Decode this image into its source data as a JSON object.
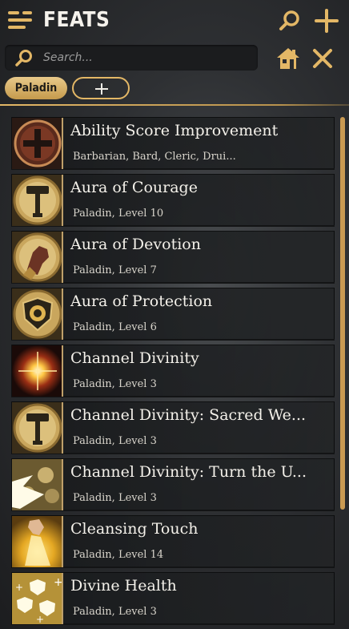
{
  "header": {
    "title": "FEATS"
  },
  "search": {
    "placeholder": "Search..."
  },
  "filters": {
    "active_chip": "Paladin"
  },
  "colors": {
    "accent": "#e3b766",
    "accent_dark": "#c59a4c",
    "background": "#2e3033"
  },
  "feats": [
    {
      "name": "Ability Score Improvement",
      "sub": "Barbarian, Bard, Cleric, Drui...",
      "icon": "plus-emblem-icon"
    },
    {
      "name": "Aura of Courage",
      "sub": "Paladin, Level 10",
      "icon": "hammer-emblem-icon"
    },
    {
      "name": "Aura of Devotion",
      "sub": "Paladin, Level 7",
      "icon": "gauntlet-emblem-icon"
    },
    {
      "name": "Aura of Protection",
      "sub": "Paladin, Level 6",
      "icon": "lion-shield-icon"
    },
    {
      "name": "Channel Divinity",
      "sub": "Paladin, Level 3",
      "icon": "radiant-burst-icon"
    },
    {
      "name": "Channel Divinity: Sacred We...",
      "sub": "Paladin, Level 3",
      "icon": "hammer-emblem-icon"
    },
    {
      "name": "Channel Divinity: Turn the U...",
      "sub": "Paladin, Level 3",
      "icon": "turn-undead-icon"
    },
    {
      "name": "Cleansing Touch",
      "sub": "Paladin, Level 14",
      "icon": "glowing-hand-icon"
    },
    {
      "name": "Divine Health",
      "sub": "Paladin, Level 3",
      "icon": "shields-cross-icon"
    }
  ]
}
